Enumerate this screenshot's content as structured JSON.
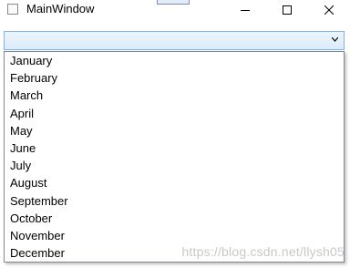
{
  "window": {
    "title": "MainWindow",
    "minimize_icon": "minimize-icon",
    "maximize_icon": "maximize-icon",
    "close_icon": "close-icon"
  },
  "combo": {
    "selected_value": "",
    "arrow_icon": "chevron-down-icon",
    "options": [
      "January",
      "February",
      "March",
      "April",
      "May",
      "June",
      "July",
      "August",
      "September",
      "October",
      "November",
      "December"
    ]
  },
  "watermark": "https://blog.csdn.net/llysh05",
  "colors": {
    "combo_border": "#7eb4ea",
    "combo_fill": "#dcecfc",
    "dropdown_border": "#828790"
  }
}
